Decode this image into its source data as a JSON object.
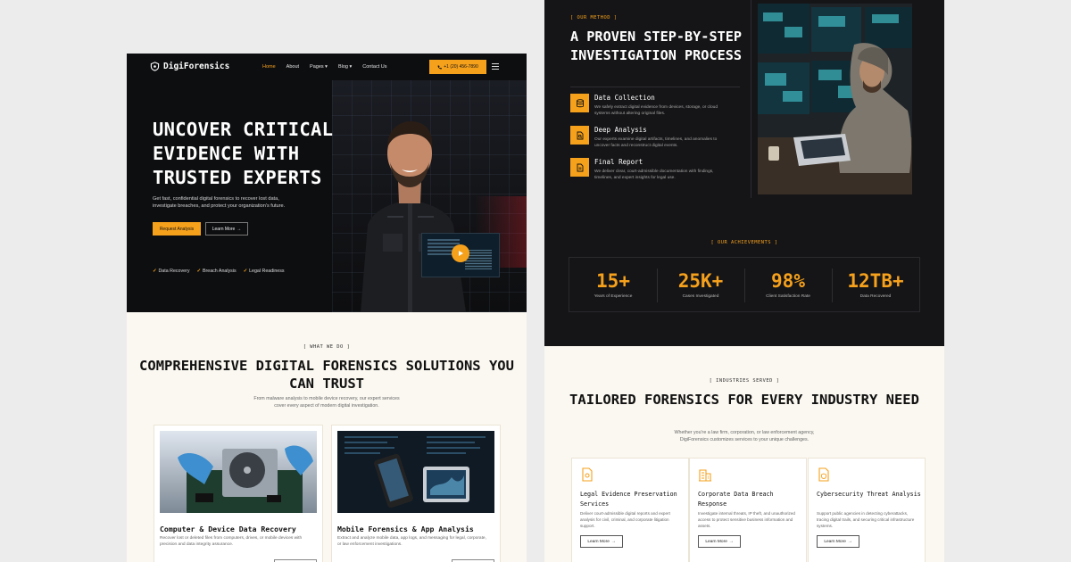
{
  "nav": {
    "brand": "DigiForensics",
    "links": [
      "Home",
      "About",
      "Pages",
      "Blog",
      "Contact Us"
    ],
    "phone": "+1 (20) 456-7890"
  },
  "hero": {
    "title": "UNCOVER CRITICAL EVIDENCE WITH TRUSTED EXPERTS",
    "subtitle": "Get fast, confidential digital forensics to recover lost data, investigate breaches, and protect your organization's future.",
    "primary_button": "Request Analysis",
    "secondary_button": "Learn More",
    "checks": [
      "Data Recovery",
      "Breach Analysis",
      "Legal Readiness"
    ]
  },
  "services": {
    "kicker": "[ WHAT WE DO ]",
    "title": "COMPREHENSIVE DIGITAL FORENSICS SOLUTIONS YOU CAN TRUST",
    "subtitle": "From malware analysis to mobile device recovery, our expert services cover every aspect of modern digital investigation.",
    "cards": [
      {
        "title": "Computer & Device Data Recovery",
        "text": "Recover lost or deleted files from computers, drives, or mobile devices with precision and data integrity assurance."
      },
      {
        "title": "Mobile Forensics & App Analysis",
        "text": "Extract and analyze mobile data, app logs, and messaging for legal, corporate, or law enforcement investigations."
      }
    ]
  },
  "method": {
    "kicker": "[ OUR METHOD ]",
    "title": "A PROVEN STEP-BY-STEP INVESTIGATION PROCESS",
    "steps": [
      {
        "title": "Data Collection",
        "text": "We safely extract digital evidence from devices, storage, or cloud systems without altering original files."
      },
      {
        "title": "Deep Analysis",
        "text": "Our experts examine digital artifacts, timelines, and anomalies to uncover facts and reconstruct digital events."
      },
      {
        "title": "Final Report",
        "text": "We deliver clear, court-admissible documentation with findings, timelines, and expert insights for legal use."
      }
    ]
  },
  "achievements": {
    "kicker": "[ OUR ACHIEVEMENTS ]",
    "stats": [
      {
        "value": "15+",
        "label": "Years of Experience"
      },
      {
        "value": "25K+",
        "label": "Cases Investigated"
      },
      {
        "value": "98%",
        "label": "Client Satisfaction Rate"
      },
      {
        "value": "12TB+",
        "label": "Data Recovered"
      }
    ]
  },
  "industries": {
    "kicker": "[ INDUSTRIES SERVED ]",
    "title": "TAILORED FORENSICS FOR EVERY INDUSTRY NEED",
    "subtitle": "Whether you're a law firm, corporation, or law enforcement agency, DigiForensics customizes services to your unique challenges.",
    "cards": [
      {
        "title": "Legal Evidence Preservation Services",
        "text": "Deliver court-admissible digital reports and expert analysis for civil, criminal, and corporate litigation support.",
        "button": "Learn More"
      },
      {
        "title": "Corporate Data Breach Response",
        "text": "Investigate internal threats, IP theft, and unauthorized access to protect sensitive business information and assets.",
        "button": "Learn More"
      },
      {
        "title": "Cybersecurity Threat Analysis",
        "text": "Support public agencies in detecting cyberattacks, tracing digital trails, and securing critical infrastructure systems.",
        "button": "Learn More"
      }
    ]
  },
  "colors": {
    "accent": "#f6a11c",
    "dark": "#151517",
    "cream": "#fbf8f1"
  }
}
